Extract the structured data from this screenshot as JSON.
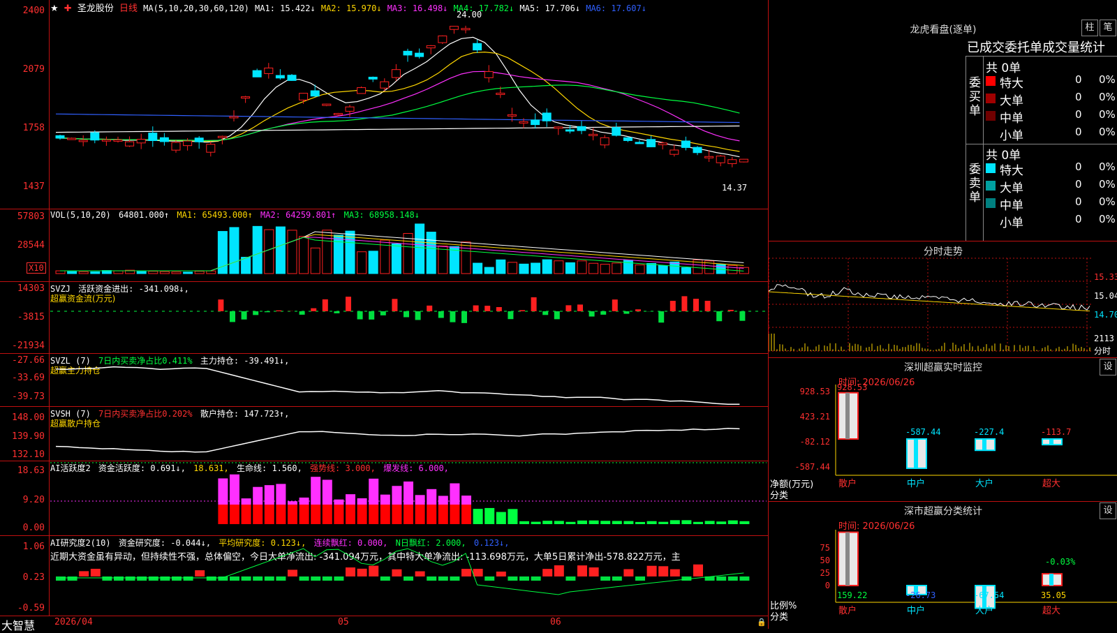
{
  "main": {
    "stock_name": "圣龙股份",
    "period": "日线",
    "ma_label": "MA(5,10,20,30,60,120)",
    "ma1": "MA1: 15.422↓",
    "ma2": "MA2: 15.970↓",
    "ma3": "MA3: 16.498↓",
    "ma4": "MA4: 17.782↓",
    "ma5": "MA5: 17.706↓",
    "ma6": "MA6: 17.607↓",
    "high_mark": "24.00",
    "low_mark": "14.37",
    "y_ticks": [
      "2400",
      "2079",
      "1758",
      "1437"
    ]
  },
  "vol": {
    "label": "VOL(5,10,20)",
    "value": "64801.000↑",
    "ma1": "MA1: 65493.000↑",
    "ma2": "MA2: 64259.801↑",
    "ma3": "MA3: 68958.148↓",
    "y_ticks": [
      "57803",
      "28544"
    ],
    "unit": "X10"
  },
  "svzj": {
    "label": "SVZJ",
    "text": "活跃资金进出: -341.098↓,",
    "sub": "超赢资金流(万元)",
    "y_ticks": [
      "14303",
      "-3815",
      "-21934"
    ]
  },
  "svzl": {
    "label": "SVZL (7)",
    "pct": "7日内买卖净占比0.411%",
    "hold": "主力持仓: -39.491↓,",
    "sub": "超赢主力持仓",
    "y_ticks": [
      "-27.66",
      "-33.69",
      "-39.73"
    ]
  },
  "svsh": {
    "label": "SVSH (7)",
    "pct": "7日内买卖净占比0.202%",
    "hold": "散户持仓: 147.723↑,",
    "sub": "超赢散户持仓",
    "y_ticks": [
      "148.00",
      "139.90",
      "132.10"
    ]
  },
  "ai1": {
    "label": "AI活跃度2",
    "act": "资金活跃度: 0.691↓,",
    "v2": "18.631,",
    "life": "生命线: 1.560,",
    "strong": "强势线: 3.000,",
    "burst": "爆发线: 6.000,",
    "y_ticks": [
      "18.63",
      "9.20",
      "0.00"
    ]
  },
  "ai2": {
    "label": "AI研究度2(10)",
    "res": "资金研究度: -0.044↓,",
    "avg": "平均研究度: 0.123↓,",
    "cont": "连续飘红: 0.000,",
    "n": "N日飘红: 2.000,",
    "last": "0.123↓,",
    "comment": "近期大资金虽有异动，但持续性不强，总体偏空，今日大单净流出: -341.094万元，其中特大单净流出: -113.698万元，大单5日累计净出-578.822万元，主",
    "y_ticks": [
      "1.06",
      "0.23",
      "-0.59"
    ]
  },
  "xaxis": {
    "brand": "大智慧",
    "dates": [
      "2026/04",
      "05",
      "06"
    ]
  },
  "dragon": {
    "title": "龙虎看盘(逐单)",
    "btn1": "柱",
    "btn2": "笔",
    "subtitle": "已成交委托单成交量统计",
    "buy_side": "委买单",
    "sell_side": "委卖单",
    "buy_total": "共 0单",
    "sell_total": "共 0单",
    "buy_rows": [
      {
        "label": "特大",
        "count": "0",
        "pct": "0%",
        "color": "#ff0000"
      },
      {
        "label": "大单",
        "count": "0",
        "pct": "0%",
        "color": "#a00000"
      },
      {
        "label": "中单",
        "count": "0",
        "pct": "0%",
        "color": "#700000"
      },
      {
        "label": "小单",
        "count": "0",
        "pct": "0%",
        "color": "#000000"
      }
    ],
    "sell_rows": [
      {
        "label": "特大",
        "count": "0",
        "pct": "0%",
        "color": "#00e5ff"
      },
      {
        "label": "大单",
        "count": "0",
        "pct": "0%",
        "color": "#00a0a0"
      },
      {
        "label": "中单",
        "count": "0",
        "pct": "0%",
        "color": "#008080"
      },
      {
        "label": "小单",
        "count": "0",
        "pct": "0%",
        "color": "#000000"
      }
    ]
  },
  "intraday": {
    "title": "分时走势",
    "prices": [
      "15.33",
      "15.04",
      "14.70"
    ],
    "vol": "2113",
    "vol_unit": "分时"
  },
  "monitor": {
    "title": "深圳超赢实时监控",
    "set": "设",
    "time": "时间: 2026/06/26",
    "y_ticks": [
      "928.53",
      "423.21",
      "-82.12",
      "-587.44"
    ],
    "y_unit": "净额(万元)",
    "x_unit": "分类",
    "categories": [
      "散户",
      "中户",
      "大户",
      "超大"
    ],
    "values": [
      "928.53",
      "-587.44",
      "-227.4",
      "-113.7"
    ]
  },
  "classify": {
    "title": "深市超赢分类统计",
    "set": "设",
    "time": "时间: 2026/06/26",
    "y_ticks": [
      "75",
      "50",
      "25",
      "0"
    ],
    "y_unit": "比例%",
    "x_unit": "分类",
    "categories": [
      "散户",
      "中户",
      "大户",
      "超大"
    ],
    "values": [
      "159.22",
      "-26.73",
      "-67.54",
      "35.05"
    ],
    "annotation": "-0.03%"
  },
  "colors": {
    "up": "#ff2020",
    "down": "#00e5ff",
    "grid": "#c01010"
  }
}
